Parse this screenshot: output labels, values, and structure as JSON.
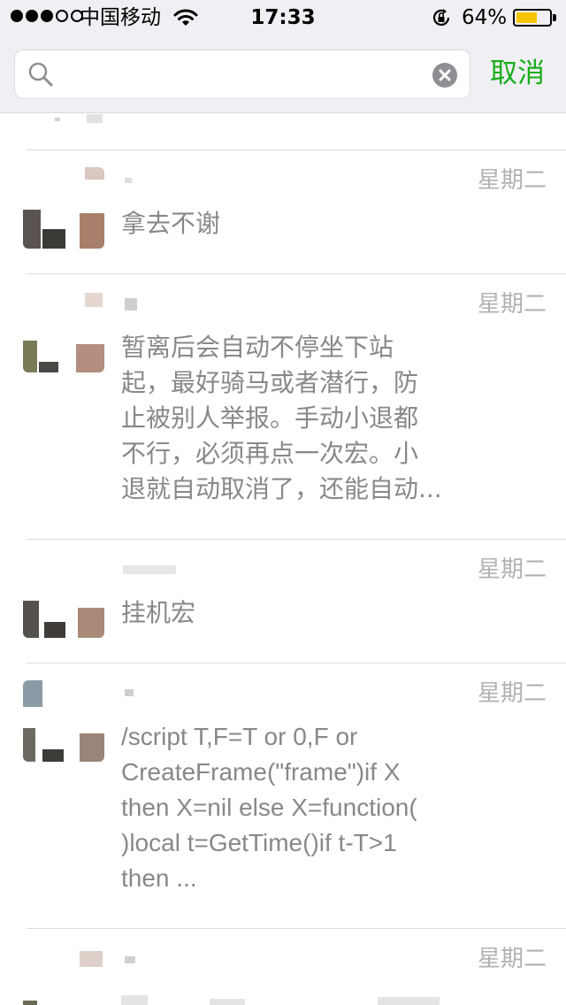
{
  "status_bar": {
    "signal_filled": 3,
    "signal_total": 5,
    "carrier": "中国移动",
    "time": "17:33",
    "battery_percent": "64%",
    "battery_level": 0.64,
    "icons": [
      "wifi-icon",
      "orientation-lock-icon",
      "battery-icon"
    ],
    "colors": {
      "battery": "#f5c400"
    }
  },
  "search": {
    "value": "",
    "placeholder": "",
    "cancel_label": "取消",
    "colors": {
      "cancel": "#1aad19"
    }
  },
  "results": [
    {
      "date": "星期二",
      "message": "拿去不谢"
    },
    {
      "date": "星期二",
      "message": "暂离后会自动不停坐下站\n起，最好骑马或者潜行，防\n止被别人举报。手动小退都\n不行，必须再点一次宏。小\n退就自动取消了，还能自动..."
    },
    {
      "date": "星期二",
      "message": "挂机宏"
    },
    {
      "date": "星期二",
      "message": "/script T,F=T or 0,F or\nCreateFrame(\"frame\")if X\nthen X=nil else X=function(\n)local t=GetTime()if t-T>1\nthen ..."
    },
    {
      "date": "星期二",
      "message": ""
    }
  ]
}
